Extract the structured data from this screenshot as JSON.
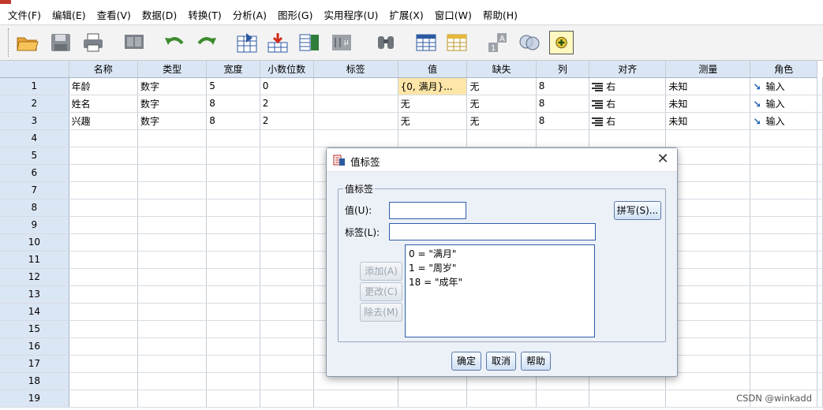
{
  "menu": [
    "文件(F)",
    "编辑(E)",
    "查看(V)",
    "数据(D)",
    "转换(T)",
    "分析(A)",
    "图形(G)",
    "实用程序(U)",
    "扩展(X)",
    "窗口(W)",
    "帮助(H)"
  ],
  "toolbar": {
    "icons": [
      "open-folder-icon",
      "save-icon",
      "print-icon",
      "dialog-recall-icon",
      "undo-icon",
      "redo-icon",
      "goto-case-icon",
      "goto-variable-icon",
      "variables-icon",
      "run-descriptives-icon",
      "find-icon",
      "split-file-icon",
      "weight-cases-icon",
      "value-labels-icon",
      "use-sets-icon",
      "add-icon"
    ]
  },
  "grid": {
    "columns": [
      "名称",
      "类型",
      "宽度",
      "小数位数",
      "标签",
      "值",
      "缺失",
      "列",
      "对齐",
      "测量",
      "角色"
    ],
    "rows": [
      {
        "n": "1",
        "cells": [
          "年龄",
          "数字",
          "5",
          "0",
          "",
          "{0, 满月}...",
          "无",
          "8",
          "右",
          "未知",
          "输入"
        ]
      },
      {
        "n": "2",
        "cells": [
          "姓名",
          "数字",
          "8",
          "2",
          "",
          "无",
          "无",
          "8",
          "右",
          "未知",
          "输入"
        ]
      },
      {
        "n": "3",
        "cells": [
          "兴趣",
          "数字",
          "8",
          "2",
          "",
          "无",
          "无",
          "8",
          "右",
          "未知",
          "输入"
        ]
      },
      {
        "n": "4",
        "cells": [
          "",
          "",
          "",
          "",
          "",
          "",
          "",
          "",
          "",
          "",
          ""
        ]
      },
      {
        "n": "5",
        "cells": [
          "",
          "",
          "",
          "",
          "",
          "",
          "",
          "",
          "",
          "",
          ""
        ]
      },
      {
        "n": "6",
        "cells": [
          "",
          "",
          "",
          "",
          "",
          "",
          "",
          "",
          "",
          "",
          ""
        ]
      },
      {
        "n": "7",
        "cells": [
          "",
          "",
          "",
          "",
          "",
          "",
          "",
          "",
          "",
          "",
          ""
        ]
      },
      {
        "n": "8",
        "cells": [
          "",
          "",
          "",
          "",
          "",
          "",
          "",
          "",
          "",
          "",
          ""
        ]
      },
      {
        "n": "9",
        "cells": [
          "",
          "",
          "",
          "",
          "",
          "",
          "",
          "",
          "",
          "",
          ""
        ]
      },
      {
        "n": "10",
        "cells": [
          "",
          "",
          "",
          "",
          "",
          "",
          "",
          "",
          "",
          "",
          ""
        ]
      },
      {
        "n": "11",
        "cells": [
          "",
          "",
          "",
          "",
          "",
          "",
          "",
          "",
          "",
          "",
          ""
        ]
      },
      {
        "n": "12",
        "cells": [
          "",
          "",
          "",
          "",
          "",
          "",
          "",
          "",
          "",
          "",
          ""
        ]
      },
      {
        "n": "13",
        "cells": [
          "",
          "",
          "",
          "",
          "",
          "",
          "",
          "",
          "",
          "",
          ""
        ]
      },
      {
        "n": "14",
        "cells": [
          "",
          "",
          "",
          "",
          "",
          "",
          "",
          "",
          "",
          "",
          ""
        ]
      },
      {
        "n": "15",
        "cells": [
          "",
          "",
          "",
          "",
          "",
          "",
          "",
          "",
          "",
          "",
          ""
        ]
      },
      {
        "n": "16",
        "cells": [
          "",
          "",
          "",
          "",
          "",
          "",
          "",
          "",
          "",
          "",
          ""
        ]
      },
      {
        "n": "17",
        "cells": [
          "",
          "",
          "",
          "",
          "",
          "",
          "",
          "",
          "",
          "",
          ""
        ]
      },
      {
        "n": "18",
        "cells": [
          "",
          "",
          "",
          "",
          "",
          "",
          "",
          "",
          "",
          "",
          ""
        ]
      },
      {
        "n": "19",
        "cells": [
          "",
          "",
          "",
          "",
          "",
          "",
          "",
          "",
          "",
          "",
          ""
        ]
      }
    ]
  },
  "dialog": {
    "title": "值标签",
    "group_label": "值标签",
    "value_label": "值(U):",
    "value_input": "",
    "label_label": "标签(L):",
    "label_input": "",
    "spell_button": "拼写(S)...",
    "add_button": "添加(A)",
    "change_button": "更改(C)",
    "remove_button": "除去(M)",
    "list_items": [
      "0 = \"满月\"",
      "1 = \"周岁\"",
      "18 = \"成年\""
    ],
    "ok_button": "确定",
    "cancel_button": "取消",
    "help_button": "帮助"
  },
  "watermark": "CSDN @winkadd",
  "colors": {
    "header_bg": "#dbe6f4",
    "highlight_cell": "#fde6a8",
    "dialog_bg": "#ecf1f8"
  }
}
